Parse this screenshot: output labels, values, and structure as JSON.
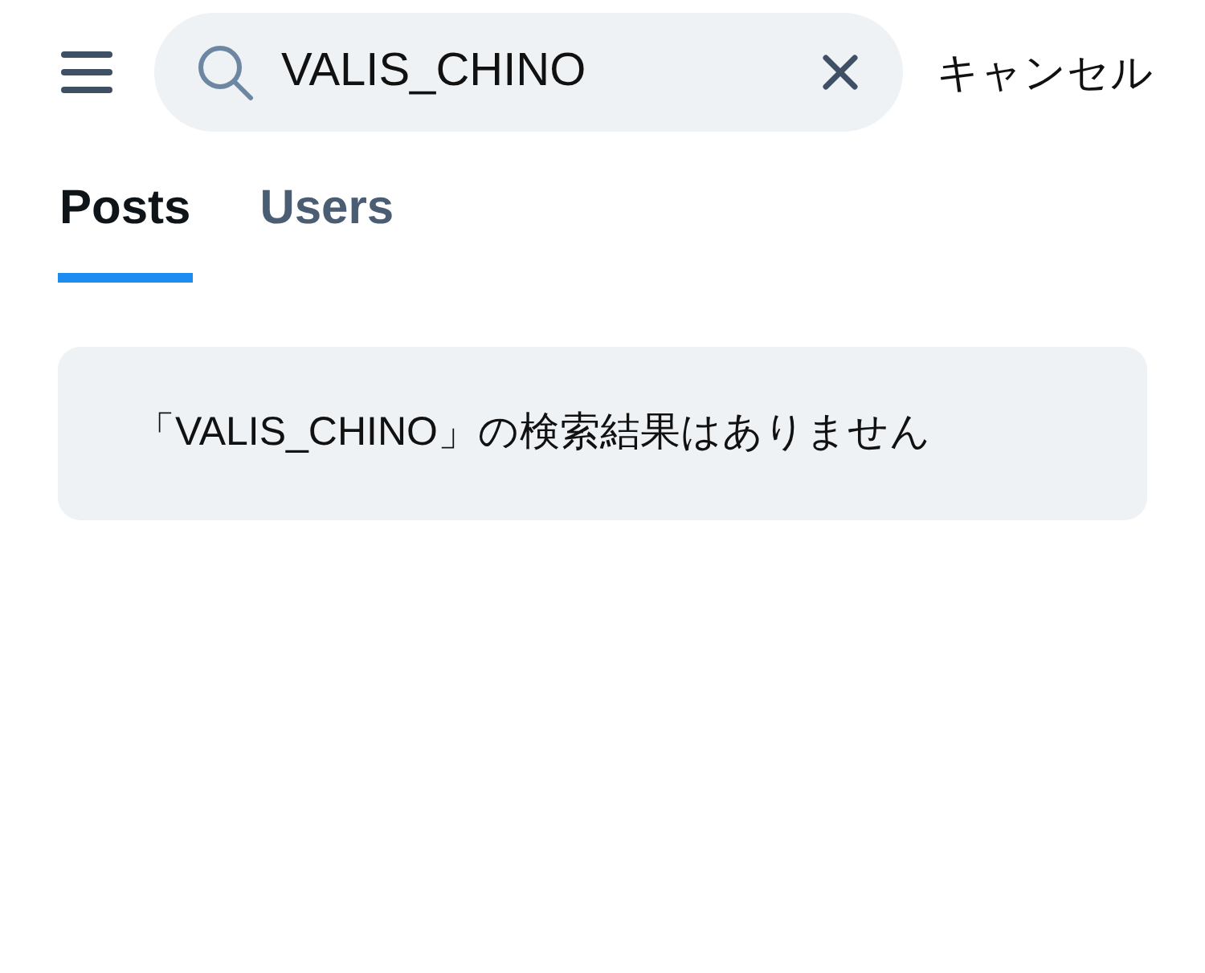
{
  "search": {
    "value": "VALIS_CHINO",
    "cancel": "キャンセル"
  },
  "tabs": [
    {
      "label": "Posts",
      "selected": true
    },
    {
      "label": "Users",
      "selected": false
    }
  ],
  "message": "「VALIS_CHINO」の検索結果はありません"
}
